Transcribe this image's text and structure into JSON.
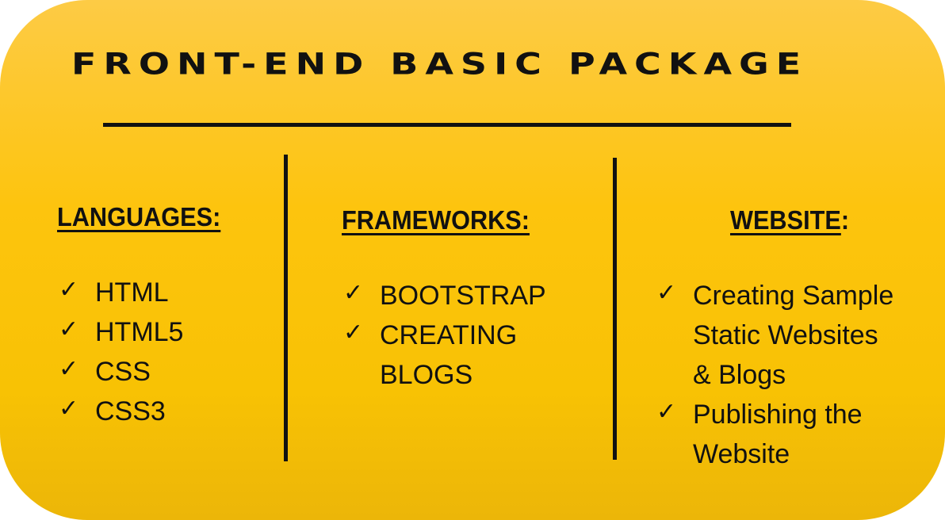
{
  "title": "FRONT-END BASIC PACKAGE",
  "columns": [
    {
      "heading": "LANGUAGES:",
      "items": [
        {
          "lines": [
            "HTML"
          ]
        },
        {
          "lines": [
            "HTML5"
          ]
        },
        {
          "lines": [
            "CSS"
          ]
        },
        {
          "lines": [
            "CSS3"
          ]
        }
      ]
    },
    {
      "heading": "FRAMEWORKS:",
      "items": [
        {
          "lines": [
            "BOOTSTRAP"
          ]
        },
        {
          "lines": [
            "CREATING",
            "BLOGS"
          ]
        }
      ]
    },
    {
      "heading_text": "WEBSITE",
      "heading_suffix": ":",
      "items": [
        {
          "lines": [
            "Creating Sample",
            "Static Websites",
            "& Blogs"
          ]
        },
        {
          "lines": [
            "Publishing the",
            "Website"
          ]
        }
      ]
    }
  ],
  "check_glyph": "✓",
  "icons": {
    "bullet": "check-mark-icon"
  },
  "colors": {
    "background": "#fdc40e",
    "text": "#111111"
  }
}
